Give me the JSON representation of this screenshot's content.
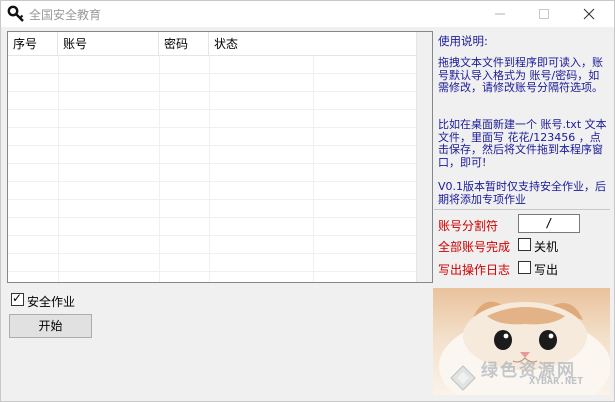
{
  "window": {
    "title": "全国安全教育",
    "minimize_icon": "minimize-icon",
    "maximize_icon": "maximize-icon",
    "close_icon": "close-icon"
  },
  "list": {
    "columns": [
      "序号",
      "账号",
      "密码",
      "状态"
    ],
    "rows": []
  },
  "instructions": {
    "title": "使用说明:",
    "p1": "拖拽文本文件到程序即可读入，账号默认导入格式为 账号/密码，如需修改，请修改账号分隔符选项。",
    "p2": "比如在桌面新建一个 账号.txt 文本文件，里面写 花花/123456 ，点击保存，然后将文件拖到本程序窗口，即可!",
    "p3": "V0.1版本暂时仅支持安全作业，后期将添加专项作业"
  },
  "options": {
    "delimiter_label": "账号分割符",
    "delimiter_value": "/",
    "all_done_label": "全部账号完成",
    "shutdown_label": "关机",
    "shutdown_checked": false,
    "log_label": "写出操作日志",
    "write_label": "写出",
    "write_checked": false
  },
  "controls": {
    "safety_homework_label": "安全作业",
    "safety_homework_checked": true,
    "start_label": "开始"
  },
  "image": {
    "watermark_cn": "绿色资源网",
    "watermark_url": "XYBAR.NET"
  },
  "colors": {
    "instructions_text": "#1a1a9a",
    "option_label": "#cc0000"
  }
}
